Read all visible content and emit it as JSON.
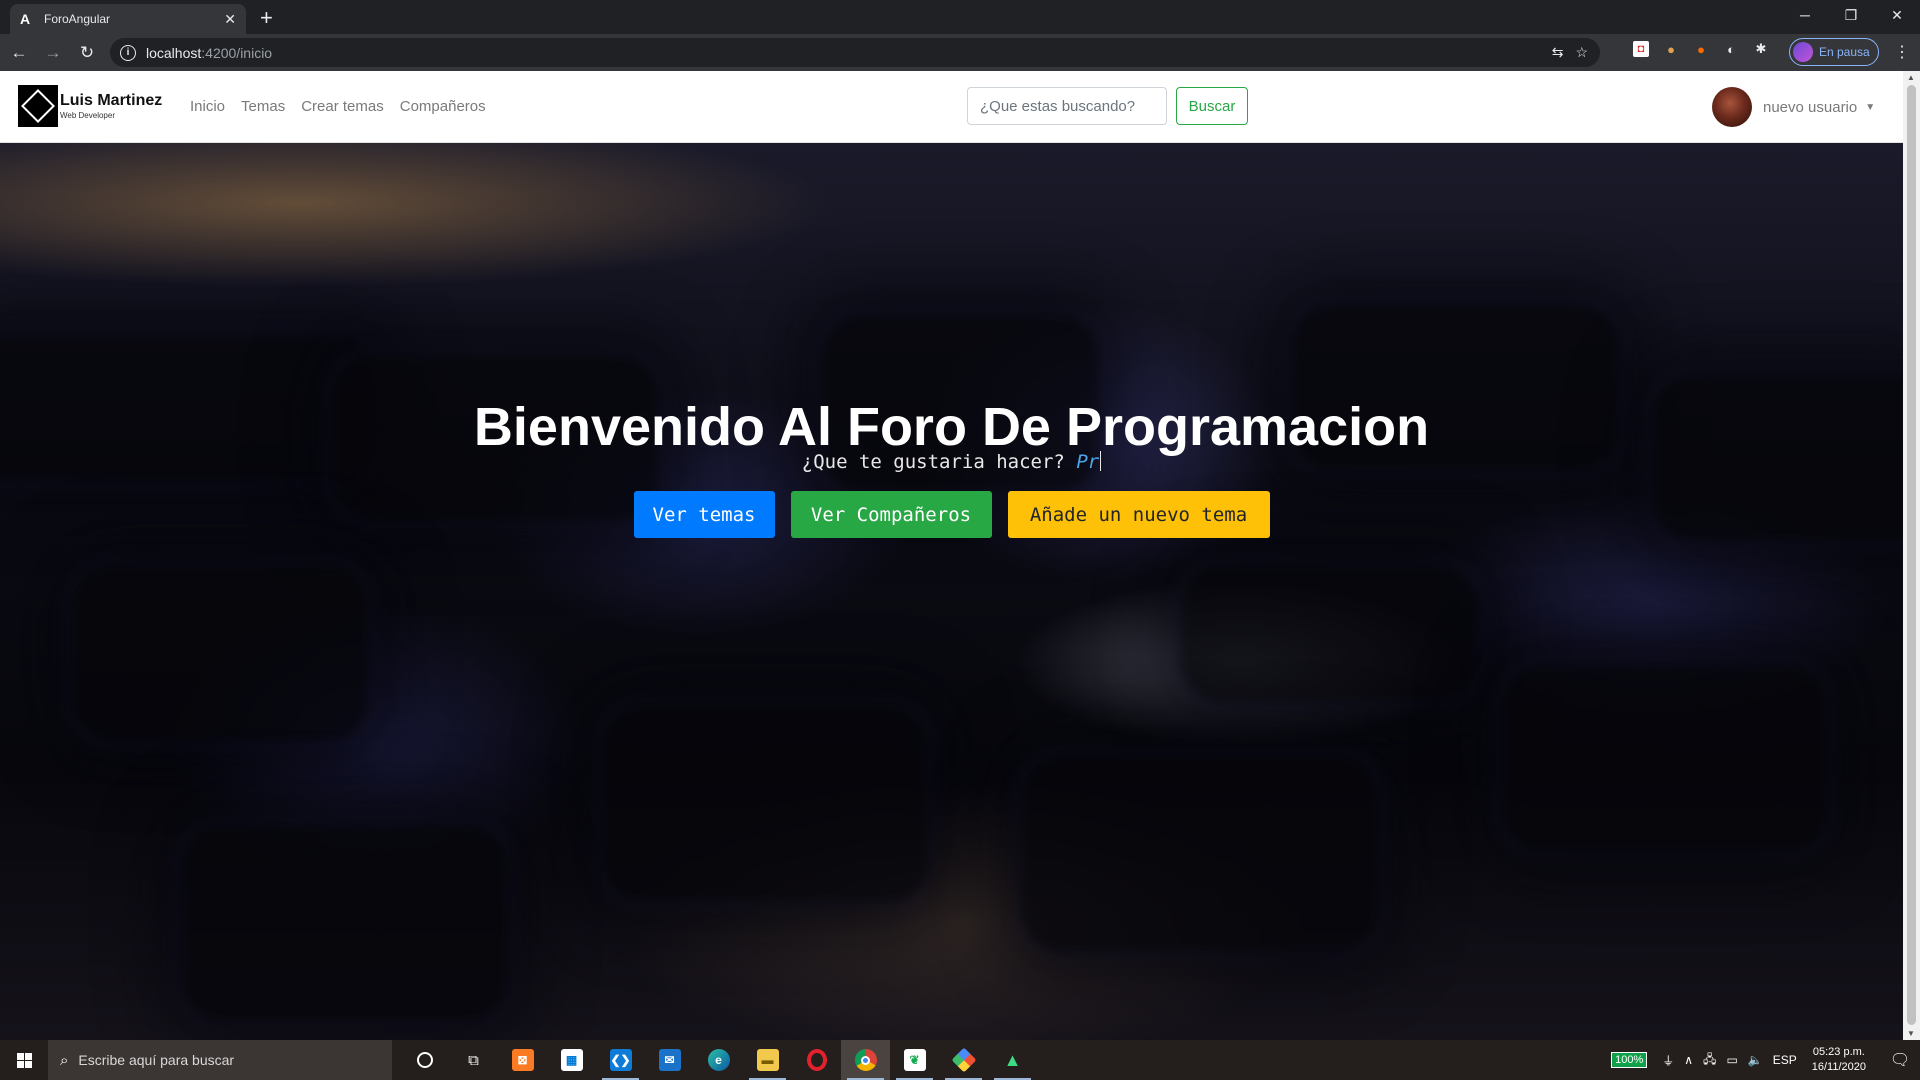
{
  "browser": {
    "tab_title": "ForoAngular",
    "tab_favicon": "A",
    "tab_close": "✕",
    "new_tab": "+",
    "url_host": "localhost",
    "url_path": ":4200/inicio",
    "profile_label": "En pausa"
  },
  "navbar": {
    "brand_name": "Luis Martinez",
    "brand_sub": "Web Developer",
    "links": [
      "Inicio",
      "Temas",
      "Crear temas",
      "Compañeros"
    ],
    "search_placeholder": "¿Que estas buscando?",
    "search_button": "Buscar",
    "user_name": "nuevo usuario"
  },
  "hero": {
    "title": "Bienvenido Al Foro De Programacion",
    "subtitle": "¿Que te gustaria hacer?",
    "typed_text": "Pr",
    "buttons": [
      "Ver temas",
      "Ver Compañeros",
      "Añade un nuevo tema"
    ]
  },
  "taskbar": {
    "search_placeholder": "Escribe aquí para buscar",
    "battery": "100%",
    "language": "ESP",
    "time": "05:23 p.m.",
    "date": "16/11/2020"
  },
  "colors": {
    "primary": "#007bff",
    "success": "#28a745",
    "warning": "#ffc107",
    "typed": "#4aa6e8"
  }
}
